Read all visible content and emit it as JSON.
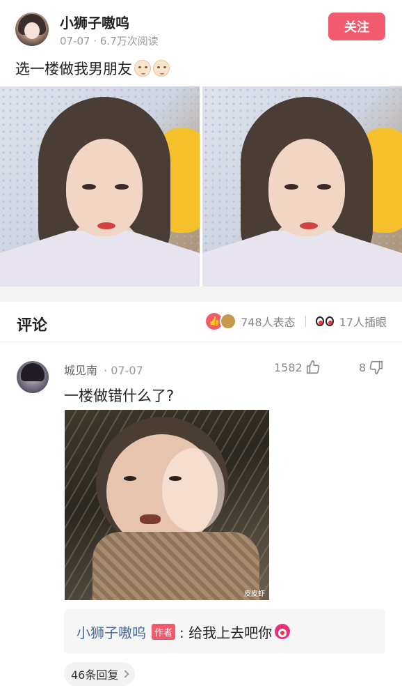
{
  "post": {
    "author": "小狮子嗷呜",
    "meta": "07-07 · 6.7万次阅读",
    "follow_label": "关注",
    "title": "选一楼做我男朋友"
  },
  "comments_section": {
    "title": "评论",
    "reactions_text": "748人表态",
    "eyes_text": "17人插眼"
  },
  "comment": {
    "user": "城见南",
    "time": "· 07-07",
    "likes": "1582",
    "dislikes": "8",
    "text": "一楼做错什么了?",
    "image_watermark": "皮皮虾",
    "reply": {
      "author": "小狮子嗷呜",
      "badge": "作者",
      "text": ": 给我上去吧你"
    },
    "more_replies": "46条回复"
  },
  "colors": {
    "accent": "#f25a6d",
    "link": "#4a6a9a"
  }
}
